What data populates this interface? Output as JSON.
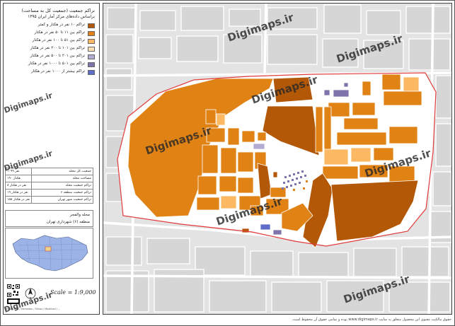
{
  "legend": {
    "title_line1": "تراکم جمعیت (جمعیت کل به مساحت)",
    "title_line2": "براساس داده‌های مرکز آمار ایران ۱۳۹۵",
    "items": [
      {
        "label": "تراکم ۱۰ نفر در هکتار و کمتر",
        "color": "#b35806"
      },
      {
        "label": "تراکم بین ۱۱ تا ۵۰ نفر در هکتار",
        "color": "#e08214"
      },
      {
        "label": "تراکم بین ۵۱ تا ۱۰۰ نفر در هکتار",
        "color": "#fdb863"
      },
      {
        "label": "تراکم بین ۱۰۱ تا ۲۰۰ نفر در هکتار",
        "color": "#fee0b6"
      },
      {
        "label": "تراکم بین ۲۰۱ تا ۵۰۰ نفر در هکتار",
        "color": "#b2abd2"
      },
      {
        "label": "تراکم بین ۵۰۱ تا ۱۰۰۰ نفر در هکتار",
        "color": "#8073ac"
      },
      {
        "label": "تراکم بیشتر از ۱۰۰۰ نفر در هکتار",
        "color": "#5e6ec8"
      }
    ]
  },
  "info_table": [
    {
      "value": "۱۰۹۹ نفر",
      "label": "جمعیت کل محله"
    },
    {
      "value": "۱۹۰ هکتار",
      "label": "مساحت محله"
    },
    {
      "value": "۸ نفر در هکتار",
      "label": "تراکم جمعیت محله"
    },
    {
      "value": "۱۹ نفر در هکتار",
      "label": "تراکم جمعیت منطقه ۶"
    },
    {
      "value": "۱۵۸ نفر در هکتار",
      "label": "تراکم جمعیت شهر تهران"
    }
  ],
  "location": {
    "neighborhood": "محله والفجر",
    "district": "منطقه (۶) شهرداری تهران"
  },
  "scale": "Scale = 1:9,000",
  "footer_small": "Tehran Map / Hamedan / Shiraz / Mashhad / ...",
  "bottom_note": "حقوق مالکیت معنوی این محصول متعلق به سایت www.digimaps.ir بوده و تمامی حقوق آن محفوظ است.",
  "watermark": "Digimaps.ir",
  "watermark_short": "Digimaps.ir",
  "colors": {
    "boundary": "#e23b3b",
    "background_map": "#e6e6e6",
    "roads": "#ffffff"
  }
}
